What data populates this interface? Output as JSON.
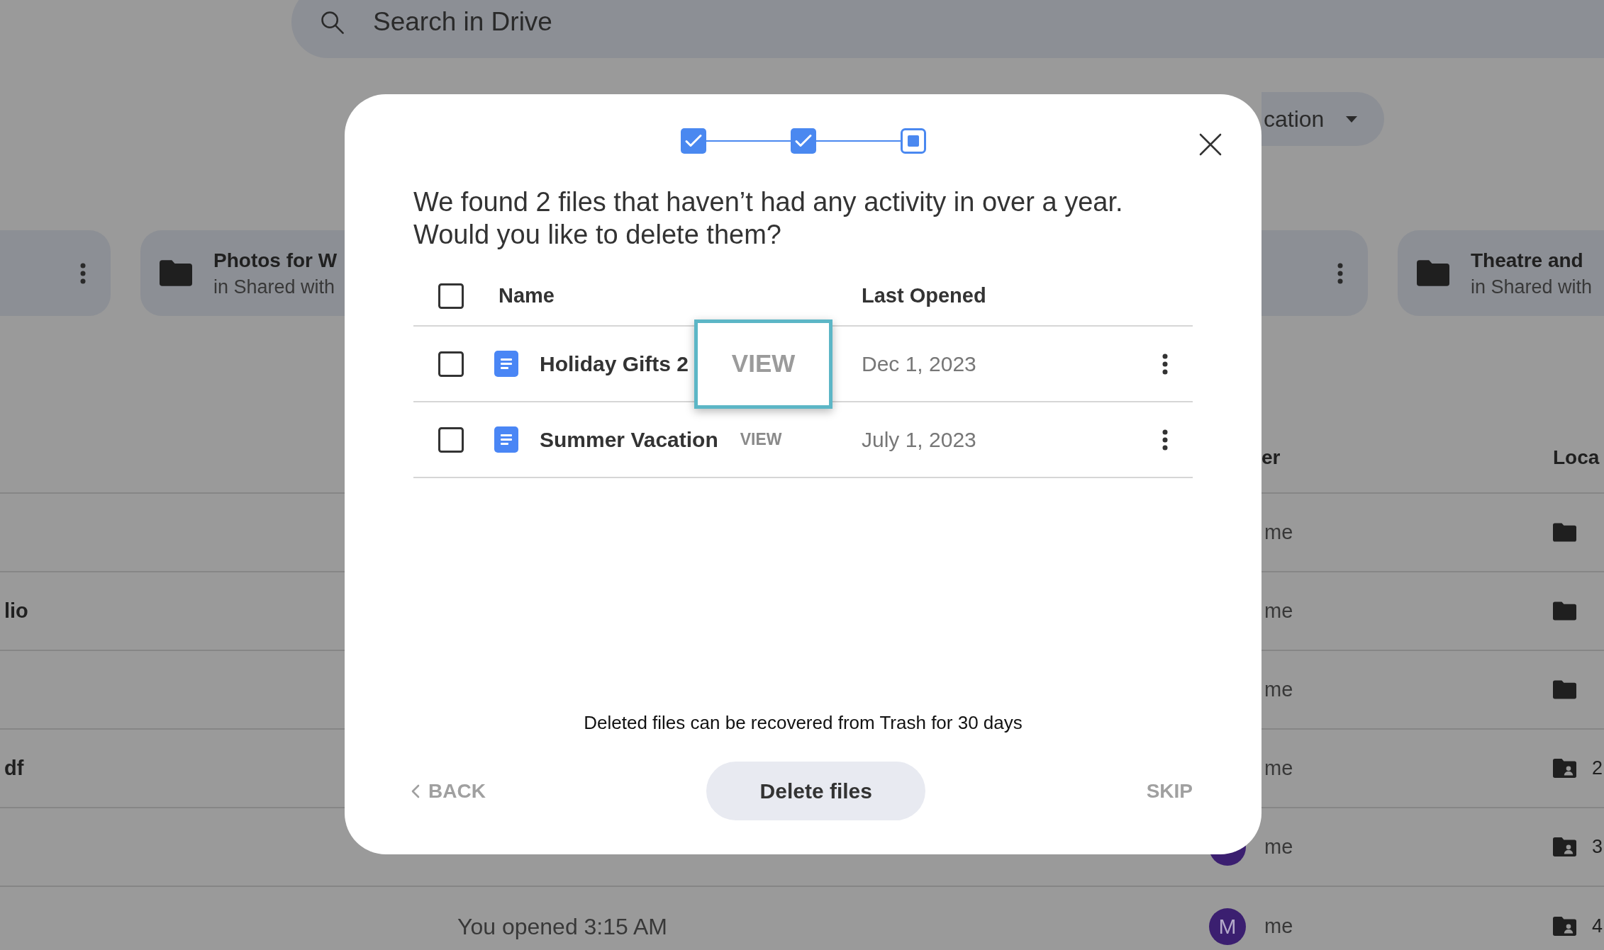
{
  "search": {
    "placeholder": "Search in Drive"
  },
  "filter_chip": {
    "label": "cation"
  },
  "folder_cards": {
    "left": [
      {
        "kind": "menu"
      },
      {
        "kind": "folder",
        "title": "Photos for W",
        "subtitle": "in Shared with"
      }
    ],
    "right": [
      {
        "kind": "menu"
      },
      {
        "kind": "folder",
        "title": "Theatre and",
        "subtitle": "in Shared with"
      }
    ]
  },
  "file_table": {
    "columns": [
      "er",
      "Loca"
    ],
    "rows": [
      {
        "owner": "me",
        "location": {
          "kind": "folder"
        }
      },
      {
        "name": "lio",
        "owner": "me",
        "location": {
          "kind": "folder"
        }
      },
      {
        "owner": "me",
        "location": {
          "kind": "folder"
        }
      },
      {
        "name": "df",
        "owner": "me",
        "location": {
          "kind": "shared",
          "label": "2"
        }
      },
      {
        "avatar": true,
        "owner": "me",
        "location": {
          "kind": "shared",
          "label": "3"
        }
      },
      {
        "activity": "You opened 3:15 AM",
        "avatar": true,
        "avatar_letter": "M",
        "owner": "me",
        "location": {
          "kind": "shared",
          "label": "4"
        }
      }
    ]
  },
  "dialog": {
    "steps": [
      {
        "kind": "done"
      },
      {
        "kind": "done"
      },
      {
        "kind": "current"
      }
    ],
    "heading": [
      "We found 2 files that haven’t had any activity in over a year.",
      "Would you like to delete them?"
    ],
    "table": {
      "select_all": {
        "checked": false
      },
      "columns": [
        "Name",
        "Last Opened"
      ],
      "rows": [
        {
          "checked": false,
          "name": "Holiday Gifts 2",
          "view": "VIEW",
          "view_highlighted": true,
          "last_opened": "Dec 1, 2023"
        },
        {
          "checked": false,
          "name": "Summer Vacation",
          "view": "VIEW",
          "view_highlighted": false,
          "last_opened": "July 1, 2023"
        }
      ]
    },
    "note": "Deleted files can be recovered from Trash for 30 days",
    "buttons": {
      "back": "BACK",
      "primary": "Delete files",
      "skip": "SKIP"
    }
  }
}
